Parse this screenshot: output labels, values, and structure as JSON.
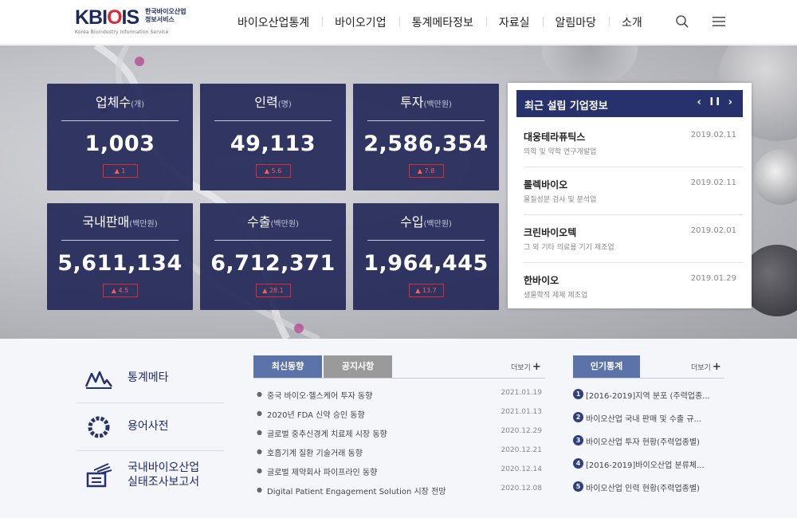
{
  "header": {
    "logo_prefix": "KBI",
    "logo_o": "O",
    "logo_suffix": "IS",
    "logo_kr_line1": "한국바이오산업",
    "logo_kr_line2": "정보서비스",
    "logo_en": "Korea Bioindustry Information Service",
    "nav": [
      "바이오산업통계",
      "바이오기업",
      "통계메타정보",
      "자료실",
      "알림마당",
      "소개"
    ],
    "icons": [
      "search-icon",
      "menu-icon"
    ]
  },
  "stats": [
    {
      "title": "업체수",
      "unit": "(개)",
      "value": "1,003",
      "change": "1"
    },
    {
      "title": "인력",
      "unit": "(명)",
      "value": "49,113",
      "change": "5.6"
    },
    {
      "title": "투자",
      "unit": "(백만원)",
      "value": "2,586,354",
      "change": "7.8"
    },
    {
      "title": "국내판매",
      "unit": "(백만원)",
      "value": "5,611,134",
      "change": "4.5"
    },
    {
      "title": "수출",
      "unit": "(백만원)",
      "value": "6,712,371",
      "change": "28.1"
    },
    {
      "title": "수입",
      "unit": "(백만원)",
      "value": "1,964,445",
      "change": "13.7"
    }
  ],
  "change_color": "#e0282f",
  "recent": {
    "title": "최근 설립 기업정보",
    "controls": "‹ II ›",
    "companies": [
      {
        "name": "대웅테라퓨틱스",
        "desc": "의학 및 약학 연구개발업",
        "date": "2019.02.11"
      },
      {
        "name": "롤렉바이오",
        "desc": "물질성분 검사 및 분석업",
        "date": "2019.02.11"
      },
      {
        "name": "크린바이오텍",
        "desc": "그 외 기타 의료용 기기 제조업",
        "date": "2019.02.01"
      },
      {
        "name": "한바이오",
        "desc": "생물학적 제제 제조업",
        "date": "2019.01.29"
      }
    ]
  },
  "quick_links": [
    {
      "label": "통계메타",
      "icon": "chart-mountain-icon"
    },
    {
      "label": "용어사전",
      "icon": "ring-icon"
    },
    {
      "label_line1": "국내바이오산업",
      "label_line2": "실태조사보고서",
      "icon": "report-icon"
    }
  ],
  "news": {
    "tab_active": "최신동향",
    "tab_idle": "공지사항",
    "more": "더보기",
    "items": [
      {
        "title": "중국 바이오·헬스케어 투자 동향",
        "date": "2021.01.19"
      },
      {
        "title": "2020년 FDA 신약 승인 동향",
        "date": "2021.01.13"
      },
      {
        "title": "글로벌 중추신경계 치료제 시장 동향",
        "date": "2020.12.29"
      },
      {
        "title": "호흡기계 질환 기술거래 동향",
        "date": "2020.12.21"
      },
      {
        "title": "글로벌 제약회사 파이프라인 동향",
        "date": "2020.12.14"
      },
      {
        "title": "Digital Patient Engagement Solution 시장 전망",
        "date": "2020.12.08"
      }
    ]
  },
  "popular": {
    "tab": "인기통계",
    "more": "더보기",
    "items": [
      {
        "num": "1",
        "title": "[2016-2019]지역 분포 (주력업종..."
      },
      {
        "num": "2",
        "title": "바이오산업 국내 판매 및 수출 규..."
      },
      {
        "num": "3",
        "title": "바이오산업 투자 현황(주력업종별)"
      },
      {
        "num": "4",
        "title": "[2016-2019]바이오산업 분류체..."
      },
      {
        "num": "5",
        "title": "바이오산업 인력 현황(주력업종별)"
      }
    ]
  }
}
